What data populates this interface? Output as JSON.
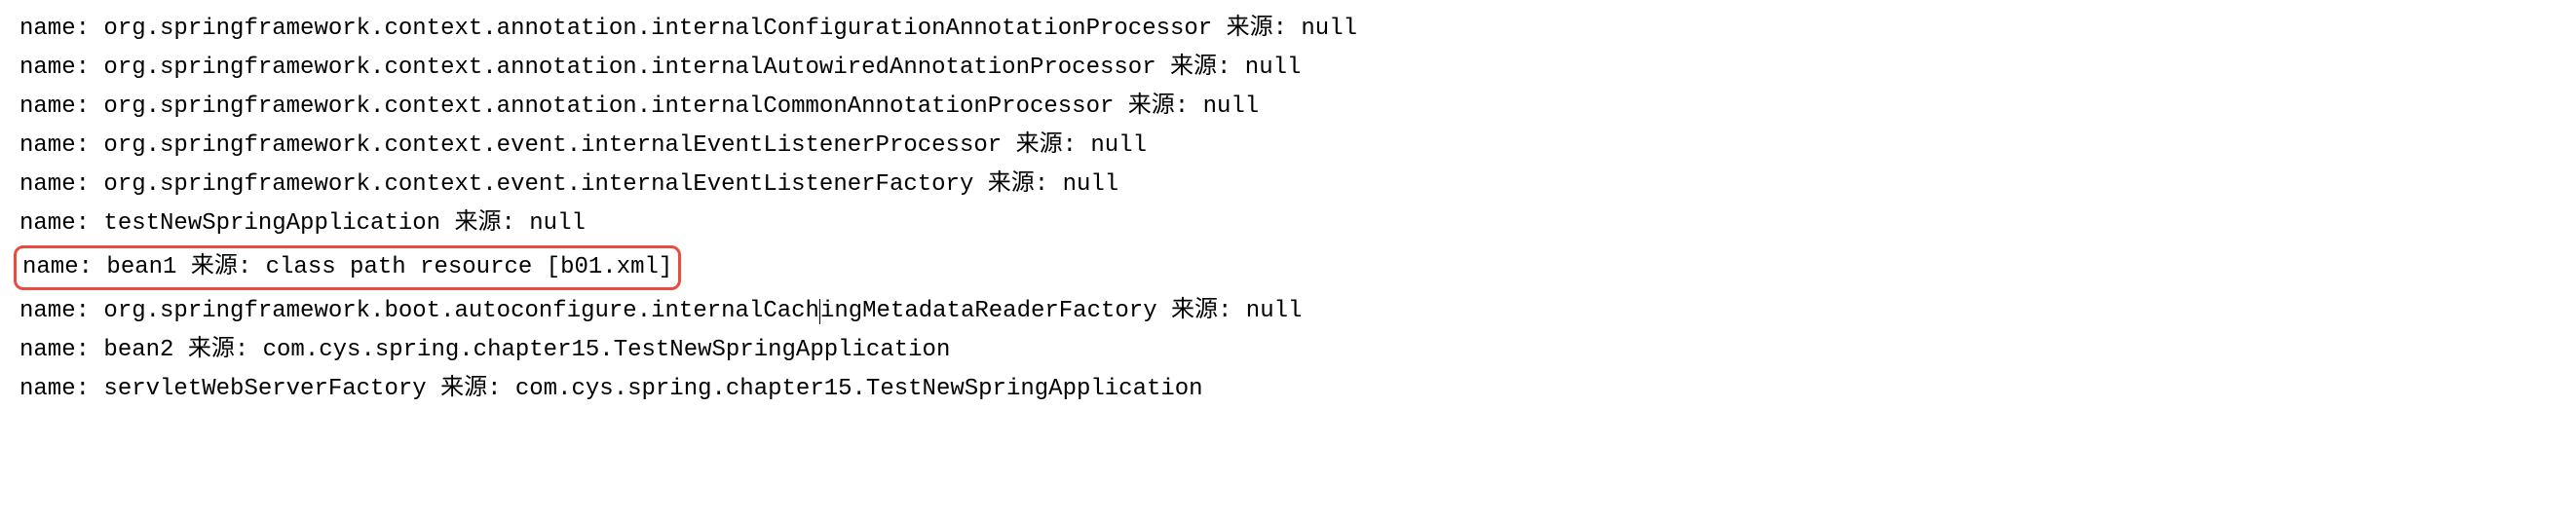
{
  "console": {
    "nameLabel": "name:",
    "sourceLabel": "来源:",
    "lines": [
      {
        "name": "org.springframework.context.annotation.internalConfigurationAnnotationProcessor",
        "source": "null",
        "highlighted": false,
        "cursorAfterCharIndex": null
      },
      {
        "name": "org.springframework.context.annotation.internalAutowiredAnnotationProcessor",
        "source": "null",
        "highlighted": false,
        "cursorAfterCharIndex": null
      },
      {
        "name": "org.springframework.context.annotation.internalCommonAnnotationProcessor",
        "source": "null",
        "highlighted": false,
        "cursorAfterCharIndex": null
      },
      {
        "name": "org.springframework.context.event.internalEventListenerProcessor",
        "source": "null",
        "highlighted": false,
        "cursorAfterCharIndex": null
      },
      {
        "name": "org.springframework.context.event.internalEventListenerFactory",
        "source": "null",
        "highlighted": false,
        "cursorAfterCharIndex": null
      },
      {
        "name": "testNewSpringApplication",
        "source": "null",
        "highlighted": false,
        "cursorAfterCharIndex": null
      },
      {
        "name": "bean1",
        "source": "class path resource [b01.xml]",
        "highlighted": true,
        "cursorAfterCharIndex": null
      },
      {
        "name": "org.springframework.boot.autoconfigure.internalCachingMetadataReaderFactory",
        "source": "null",
        "highlighted": false,
        "cursorAfterCharIndex": 51
      },
      {
        "name": "bean2",
        "source": "com.cys.spring.chapter15.TestNewSpringApplication",
        "highlighted": false,
        "cursorAfterCharIndex": null
      },
      {
        "name": "servletWebServerFactory",
        "source": "com.cys.spring.chapter15.TestNewSpringApplication",
        "highlighted": false,
        "cursorAfterCharIndex": null
      }
    ]
  }
}
